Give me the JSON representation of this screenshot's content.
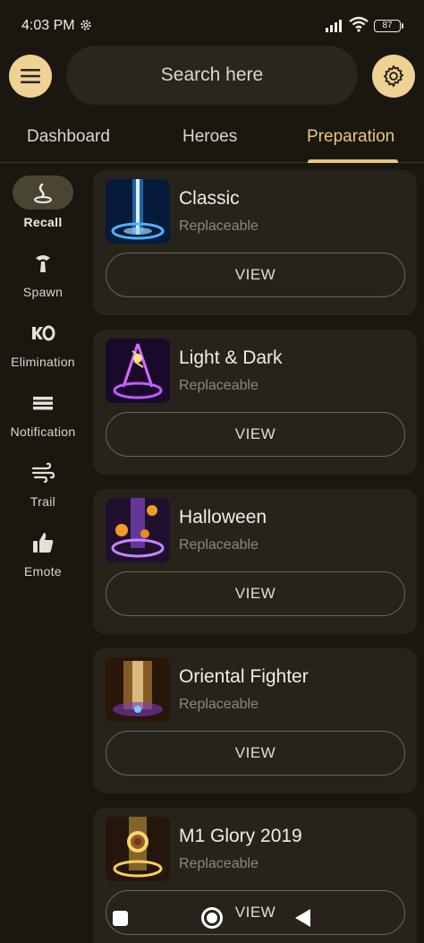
{
  "status_bar": {
    "time": "4:03 PM",
    "battery": "87"
  },
  "search": {
    "placeholder": "Search here"
  },
  "tabs": [
    {
      "label": "Dashboard",
      "active": false
    },
    {
      "label": "Heroes",
      "active": false
    },
    {
      "label": "Preparation",
      "active": true
    }
  ],
  "sidebar": {
    "items": [
      {
        "label": "Recall",
        "icon": "recall-icon",
        "selected": true
      },
      {
        "label": "Spawn",
        "icon": "spawn-icon",
        "selected": false
      },
      {
        "label": "Elimination",
        "icon": "ko-icon",
        "selected": false
      },
      {
        "label": "Notification",
        "icon": "notification-icon",
        "selected": false
      },
      {
        "label": "Trail",
        "icon": "wind-icon",
        "selected": false
      },
      {
        "label": "Emote",
        "icon": "thumbs-up-icon",
        "selected": false
      }
    ]
  },
  "cards": [
    {
      "title": "Classic",
      "subtitle": "Replaceable",
      "button": "VIEW"
    },
    {
      "title": "Light & Dark",
      "subtitle": "Replaceable",
      "button": "VIEW"
    },
    {
      "title": "Halloween",
      "subtitle": "Replaceable",
      "button": "VIEW"
    },
    {
      "title": "Oriental Fighter",
      "subtitle": "Replaceable",
      "button": "VIEW"
    },
    {
      "title": "M1 Glory 2019",
      "subtitle": "Replaceable",
      "button": "VIEW"
    }
  ],
  "colors": {
    "accent": "#e8c877",
    "button_fill": "#eed395",
    "background": "#1a1711",
    "card": "#27231b"
  }
}
